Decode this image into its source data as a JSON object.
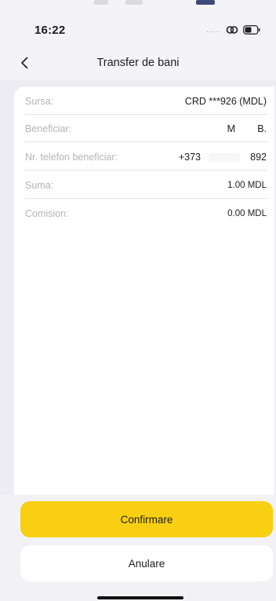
{
  "status_bar": {
    "time": "16:22",
    "signal_dots": "....."
  },
  "header": {
    "title": "Transfer de bani",
    "back_icon": "chevron-left-icon"
  },
  "details": [
    {
      "label": "Sursa:",
      "value": "CRD ***926 (MDL)"
    },
    {
      "label": "Beneficiar:",
      "value_first": "M",
      "value_last": "B."
    },
    {
      "label": "Nr. telefon beneficiar:",
      "value_prefix": "+373",
      "value_suffix": "892"
    },
    {
      "label": "Suma:",
      "value": "1.00 MDL"
    },
    {
      "label": "Comision:",
      "value": "0.00 MDL"
    }
  ],
  "actions": {
    "confirm_label": "Confirmare",
    "cancel_label": "Anulare"
  },
  "colors": {
    "accent": "#f9cf11",
    "background": "#ececf2"
  }
}
